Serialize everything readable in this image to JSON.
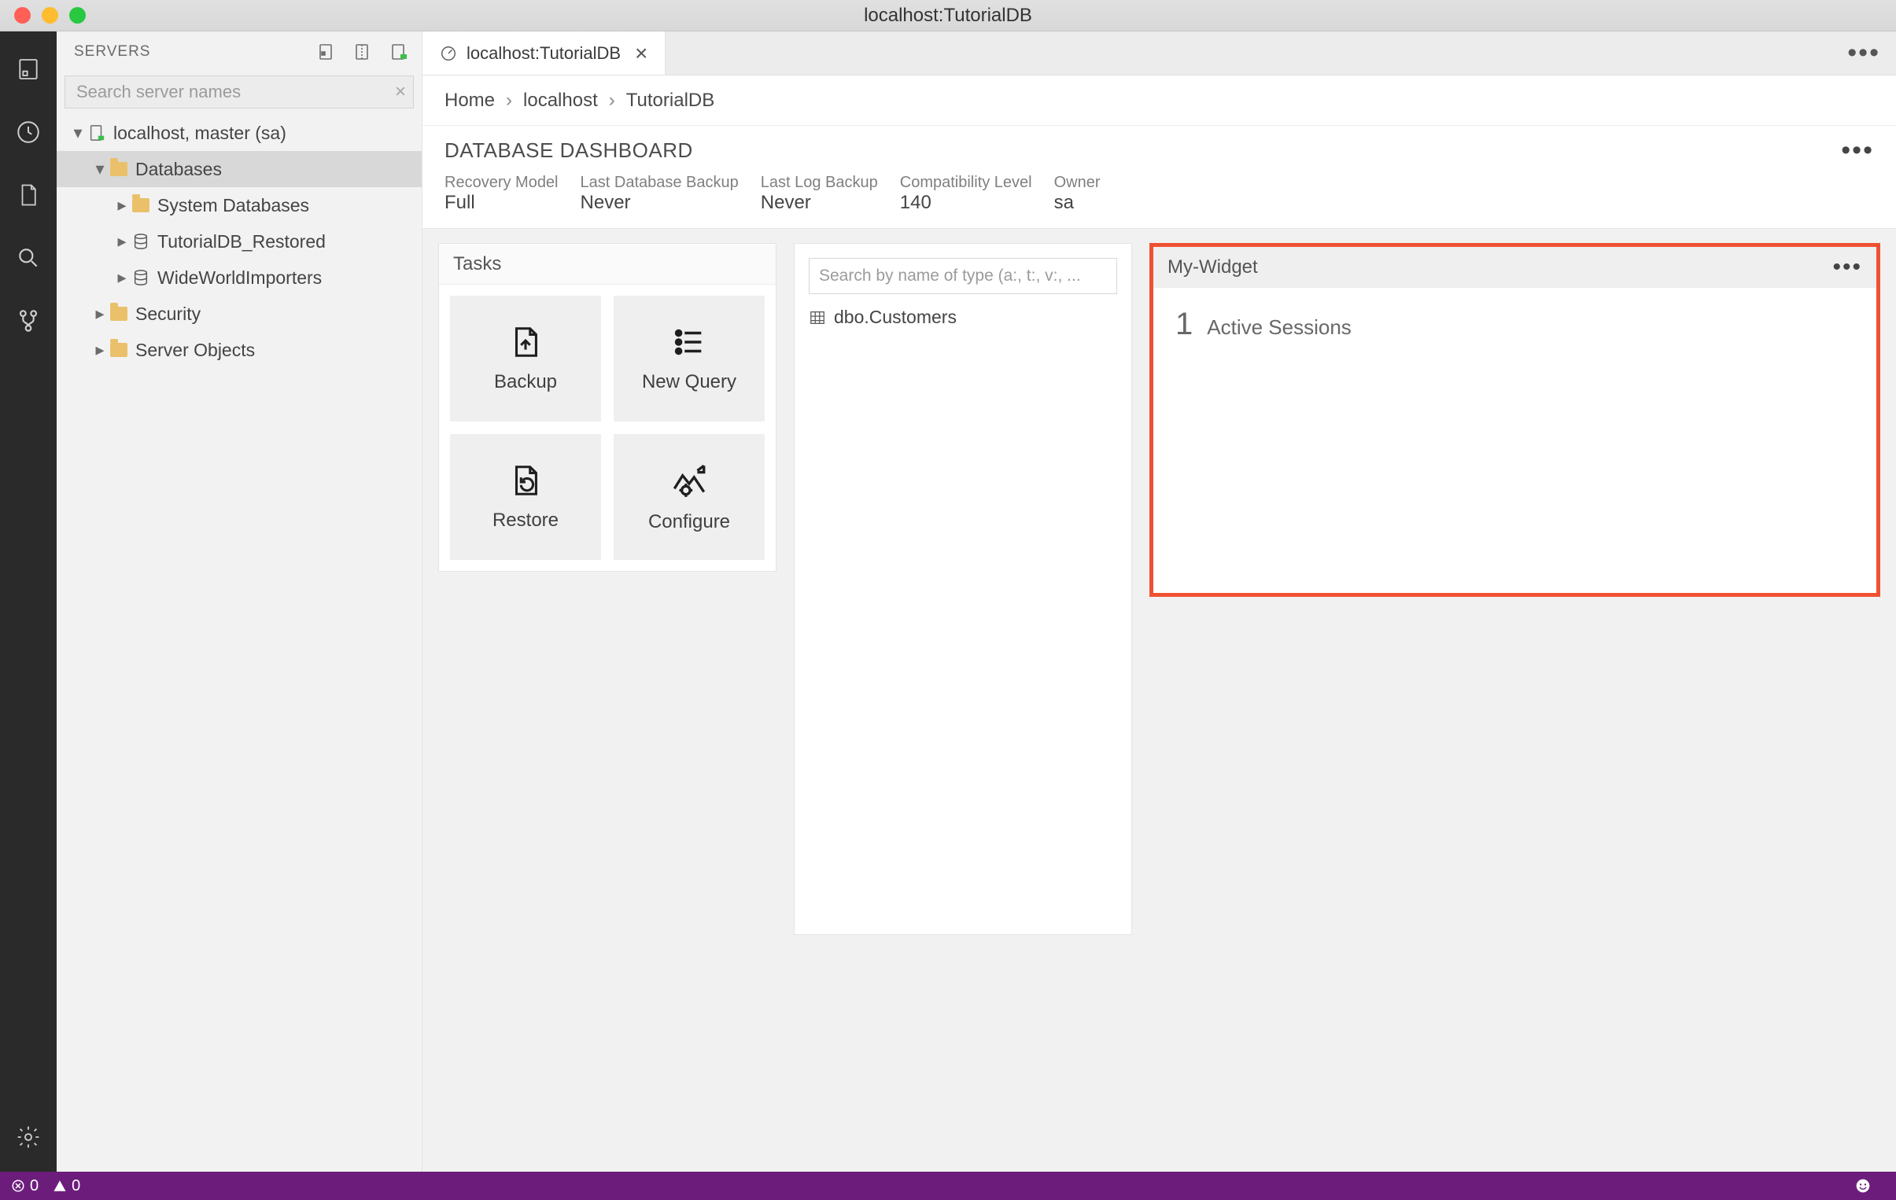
{
  "window": {
    "title": "localhost:TutorialDB"
  },
  "sidepanel": {
    "title": "SERVERS",
    "search_placeholder": "Search server names"
  },
  "tree": {
    "server": "localhost, master (sa)",
    "databases": "Databases",
    "children": {
      "system": "System Databases",
      "restored": "TutorialDB_Restored",
      "wwi": "WideWorldImporters"
    },
    "security": "Security",
    "server_objects": "Server Objects"
  },
  "tab": {
    "label": "localhost:TutorialDB"
  },
  "breadcrumb": {
    "home": "Home",
    "host": "localhost",
    "db": "TutorialDB"
  },
  "dashboard": {
    "heading": "DATABASE DASHBOARD",
    "metrics": {
      "recovery": {
        "label": "Recovery Model",
        "value": "Full"
      },
      "lastdb": {
        "label": "Last Database Backup",
        "value": "Never"
      },
      "lastlog": {
        "label": "Last Log Backup",
        "value": "Never"
      },
      "compat": {
        "label": "Compatibility Level",
        "value": "140"
      },
      "owner": {
        "label": "Owner",
        "value": "sa"
      }
    }
  },
  "tasks": {
    "title": "Tasks",
    "backup": "Backup",
    "newquery": "New Query",
    "restore": "Restore",
    "configure": "Configure"
  },
  "searchpanel": {
    "placeholder": "Search by name of type (a:, t:, v:, ...",
    "result0": "dbo.Customers"
  },
  "widget": {
    "title": "My-Widget",
    "count": "1",
    "label": "Active Sessions"
  },
  "status": {
    "errors": "0",
    "warnings": "0"
  }
}
